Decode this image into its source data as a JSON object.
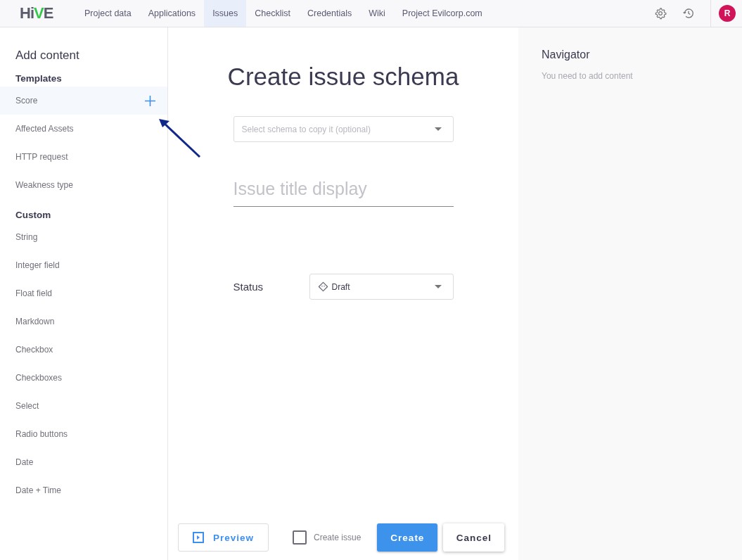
{
  "logo": {
    "parts": [
      {
        "text": "Hi",
        "kind": "plain"
      },
      {
        "text": "V",
        "kind": "accent"
      },
      {
        "text": "E",
        "kind": "plain"
      }
    ]
  },
  "nav": [
    {
      "label": "Project data",
      "selected": false
    },
    {
      "label": "Applications",
      "selected": false
    },
    {
      "label": "Issues",
      "selected": true
    },
    {
      "label": "Checklist",
      "selected": false
    },
    {
      "label": "Credentials",
      "selected": false
    },
    {
      "label": "Wiki",
      "selected": false
    },
    {
      "label": "Project Evilcorp.com",
      "selected": false
    }
  ],
  "user": {
    "initial": "R"
  },
  "sidebar": {
    "title": "Add content",
    "sections": [
      {
        "heading": "Templates",
        "items": [
          {
            "label": "Score",
            "selected": true
          },
          {
            "label": "Affected Assets",
            "selected": false
          },
          {
            "label": "HTTP request",
            "selected": false
          },
          {
            "label": "Weakness type",
            "selected": false
          }
        ]
      },
      {
        "heading": "Custom",
        "items": [
          {
            "label": "String",
            "selected": false
          },
          {
            "label": "Integer field",
            "selected": false
          },
          {
            "label": "Float field",
            "selected": false
          },
          {
            "label": "Markdown",
            "selected": false
          },
          {
            "label": "Checkbox",
            "selected": false
          },
          {
            "label": "Checkboxes",
            "selected": false
          },
          {
            "label": "Select",
            "selected": false
          },
          {
            "label": "Radio buttons",
            "selected": false
          },
          {
            "label": "Date",
            "selected": false
          },
          {
            "label": "Date + Time",
            "selected": false
          }
        ]
      }
    ]
  },
  "form": {
    "title": "Create issue schema",
    "copy_select": {
      "placeholder": "Select schema to copy it (optional)"
    },
    "title_field": {
      "placeholder": "Issue title display"
    },
    "status": {
      "label": "Status",
      "value": "Draft"
    }
  },
  "footer": {
    "preview": "Preview",
    "create_issue": {
      "label": "Create issue",
      "checked": false
    },
    "create": "Create",
    "cancel": "Cancel"
  },
  "navigator": {
    "title": "Navigator",
    "empty": "You need to add content"
  }
}
